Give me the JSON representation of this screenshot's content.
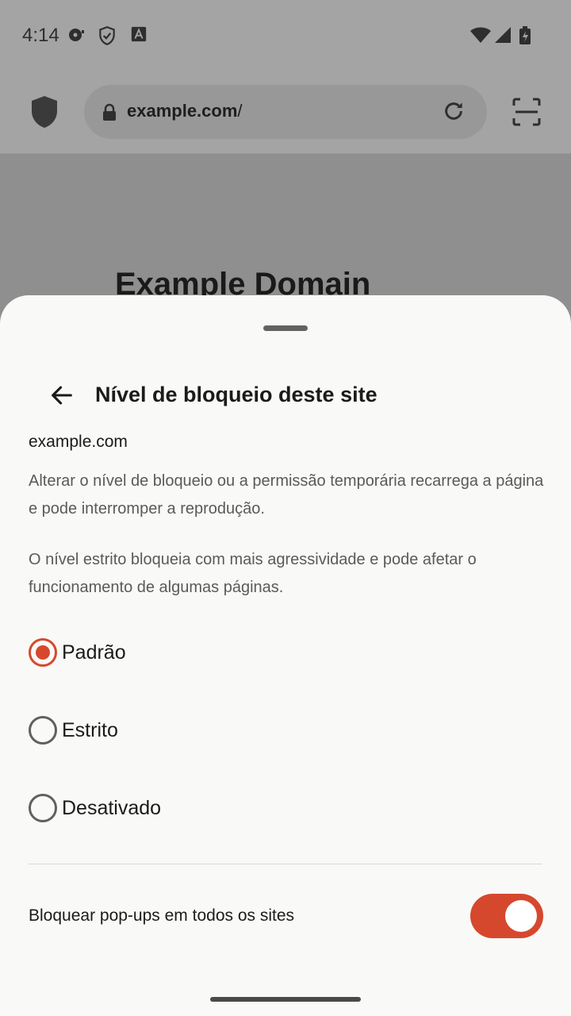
{
  "status_bar": {
    "time": "4:14"
  },
  "browser": {
    "url_host": "example.com",
    "url_path": "/"
  },
  "page": {
    "heading": "Example Domain"
  },
  "sheet": {
    "title": "Nível de bloqueio deste site",
    "site": "example.com",
    "description_1": "Alterar o nível de bloqueio ou a permissão temporária recarrega a página e pode interromper a reprodução.",
    "description_2": "O nível estrito bloqueia com mais agressividade e pode afetar o funcionamento de algumas páginas.",
    "options": [
      {
        "label": "Padrão",
        "selected": true
      },
      {
        "label": "Estrito",
        "selected": false
      },
      {
        "label": "Desativado",
        "selected": false
      }
    ],
    "popup_toggle": {
      "label": "Bloquear pop-ups em todos os sites",
      "on": true
    }
  },
  "colors": {
    "accent": "#d6482e",
    "sheet_background": "#f9f9f7",
    "scrim": "#8f8f8f"
  }
}
